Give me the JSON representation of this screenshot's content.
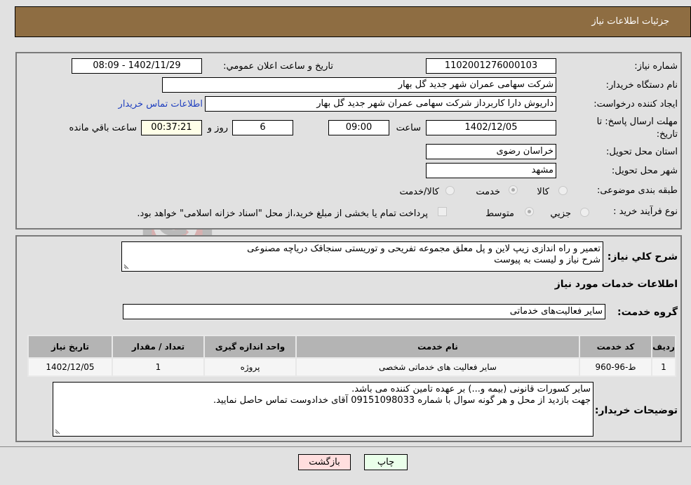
{
  "header": {
    "title": "جزئیات اطلاعات نیاز"
  },
  "details": {
    "need_number_label": "شماره نیاز:",
    "need_number": "1102001276000103",
    "announce_label": "تاريخ و ساعت اعلان عمومي:",
    "announce_value": "1402/11/29 - 08:09",
    "buyer_org_label": "نام دستگاه خریدار:",
    "buyer_org": "شرکت سهامی عمران شهر جدید گل بهار",
    "creator_label": "ایجاد کننده درخواست:",
    "creator": "داریوش دارا کاربرداز شرکت سهامی عمران شهر جدید گل بهار",
    "buyer_contact_link": "اطلاعات تماس خریدار",
    "deadline_label_1": "مهلت ارسال پاسخ: تا",
    "deadline_label_2": "تاریخ:",
    "deadline_date": "1402/12/05",
    "time_label": "ساعت",
    "deadline_time": "09:00",
    "days_value": "6",
    "days_label": "روز و",
    "remaining_time": "00:37:21",
    "remaining_label": "ساعت باقي مانده",
    "province_label": "استان محل تحویل:",
    "province": "خراسان رضوی",
    "city_label": "شهر محل تحویل:",
    "city": "مشهد",
    "category_label": "طبقه بندی موضوعی:",
    "category_options": [
      {
        "label": "کالا",
        "checked": false
      },
      {
        "label": "خدمت",
        "checked": true
      },
      {
        "label": "کالا/خدمت",
        "checked": false
      }
    ],
    "process_label": "نوع فرآیند خرید :",
    "process_options": [
      {
        "label": "جزيي",
        "checked": false
      },
      {
        "label": "متوسط",
        "checked": true
      }
    ],
    "treasury_checkbox_label": "پرداخت تمام یا بخشی از مبلغ خرید،از محل \"اسناد خزانه اسلامی\" خواهد بود."
  },
  "description": {
    "label": "شرح کلي نياز:",
    "text_line1": "تعمیر و راه اندازی زیپ لاین و پل معلق مجموعه تفریحی و توریستی سنجاقک دریاچه مصنوعی",
    "text_line2": "شرح نیاز و لیست به پیوست"
  },
  "services": {
    "section_title": "اطلاعات خدمات مورد نیاز",
    "group_label": "گروه خدمت:",
    "group_value": "سایر فعالیت‌های خدماتی",
    "table": {
      "headers": [
        "ردیف",
        "کد خدمت",
        "نام خدمت",
        "واحد اندازه گیری",
        "تعداد / مقدار",
        "تاریخ نیاز"
      ],
      "rows": [
        [
          "1",
          "ط-96-960",
          "سایر فعالیت های خدماتی شخصی",
          "پروژه",
          "1",
          "1402/12/05"
        ]
      ]
    }
  },
  "buyer_notes": {
    "label": "توضیحات خریدار:",
    "line1": "سایر کسورات قانونی (بیمه و...) بر عهده تامین کننده می باشد.",
    "line2": "جهت بازدید از محل و هر گونه سوال با شماره 09151098033 آقای خدادوست تماس حاصل نمایید."
  },
  "buttons": {
    "print": "چاپ",
    "back": "بازگشت"
  },
  "colors": {
    "header_bg": "#8e6d42",
    "link": "#1f3fbf",
    "print_bg": "#eaffea",
    "back_bg": "#ffdede",
    "remaining_bg": "#ffffe8"
  }
}
